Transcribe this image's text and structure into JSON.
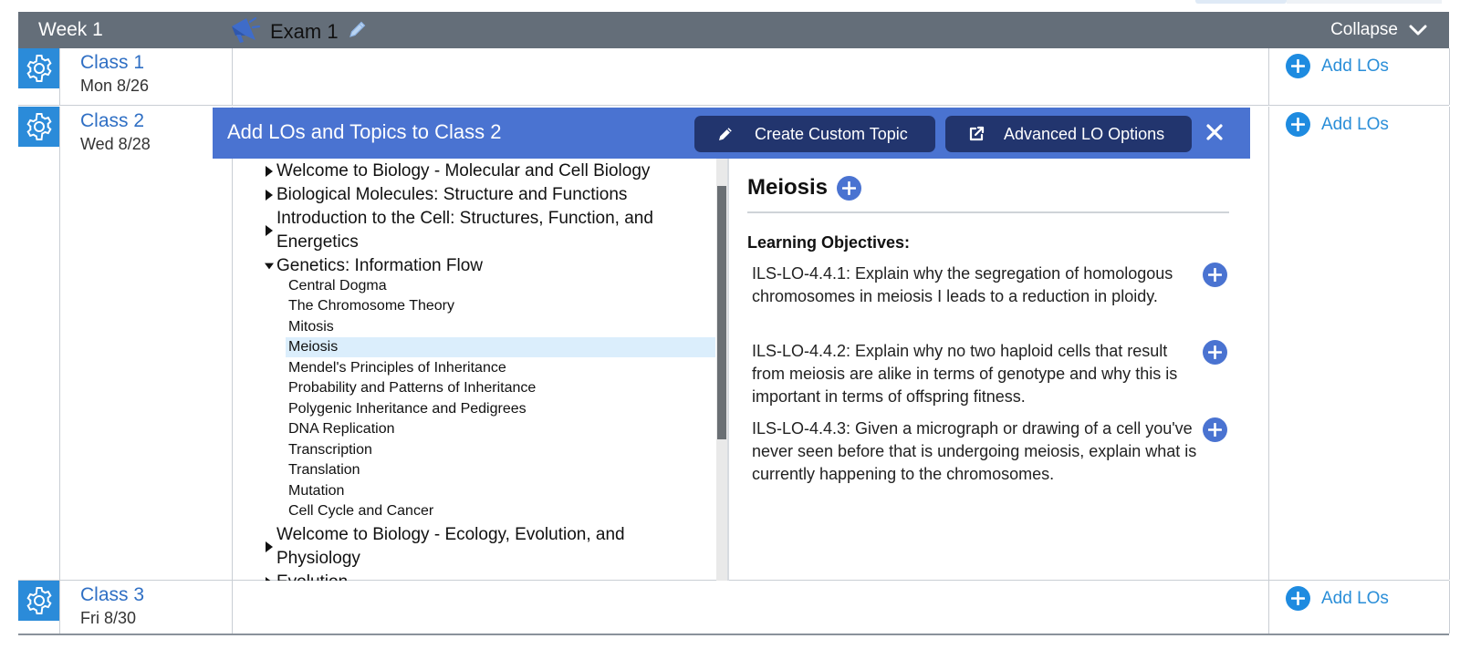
{
  "week": {
    "title": "Week 1",
    "collapse_label": "Collapse"
  },
  "classes": [
    {
      "name": "Class 1",
      "date": "Mon 8/26",
      "add_label": "Add LOs"
    },
    {
      "name": "Class 2",
      "date": "Wed 8/28",
      "add_label": "Add LOs"
    },
    {
      "name": "Class 3",
      "date": "Fri 8/30",
      "add_label": "Add LOs"
    }
  ],
  "exam": {
    "label": "Exam 1"
  },
  "panel": {
    "title": "Add LOs and Topics to Class 2",
    "create_custom_label": "Create Custom Topic",
    "advanced_label": "Advanced LO Options",
    "tree": {
      "top": [
        "Welcome to Biology - Molecular and Cell Biology",
        "Biological Molecules: Structure and Functions",
        "Introduction to the Cell: Structures, Function, and Energetics",
        "Genetics: Information Flow",
        "Welcome to Biology - Ecology, Evolution, and Physiology",
        "Evolution"
      ],
      "genetics_children": [
        "Central Dogma",
        "The Chromosome Theory",
        "Mitosis",
        "Meiosis",
        "Mendel's Principles of Inheritance",
        "Probability and Patterns of Inheritance",
        "Polygenic Inheritance and Pedigrees",
        "DNA Replication",
        "Transcription",
        "Translation",
        "Mutation",
        "Cell Cycle and Cancer"
      ],
      "selected": "Meiosis"
    },
    "detail": {
      "topic": "Meiosis",
      "lo_heading": "Learning Objectives:",
      "objectives": [
        "ILS-LO-4.4.1: Explain why the segregation of homologous chromosomes in meiosis I leads to a reduction in ploidy.",
        "ILS-LO-4.4.2: Explain why no two haploid cells that result from meiosis are alike in terms of genotype and why this is important in terms of offspring fitness.",
        "ILS-LO-4.4.3: Given a micrograph or drawing of a cell you've never seen before that is undergoing meiosis, explain what is currently happening to the chromosomes."
      ]
    }
  },
  "colors": {
    "week_header": "#646e79",
    "gear_bg": "#2b8bd9",
    "class_link": "#2f6fc4",
    "add_los": "#2a8ed8",
    "panel_header": "#4a73d1",
    "dark_button": "#22356e",
    "selected_row": "#dbeefc"
  },
  "icons": {
    "gear": "gear-icon",
    "megaphone": "megaphone-icon",
    "pencil": "pencil-icon",
    "external": "external-link-icon",
    "close": "close-icon",
    "plus": "plus-circle-icon",
    "chevron": "chevron-down-icon"
  }
}
